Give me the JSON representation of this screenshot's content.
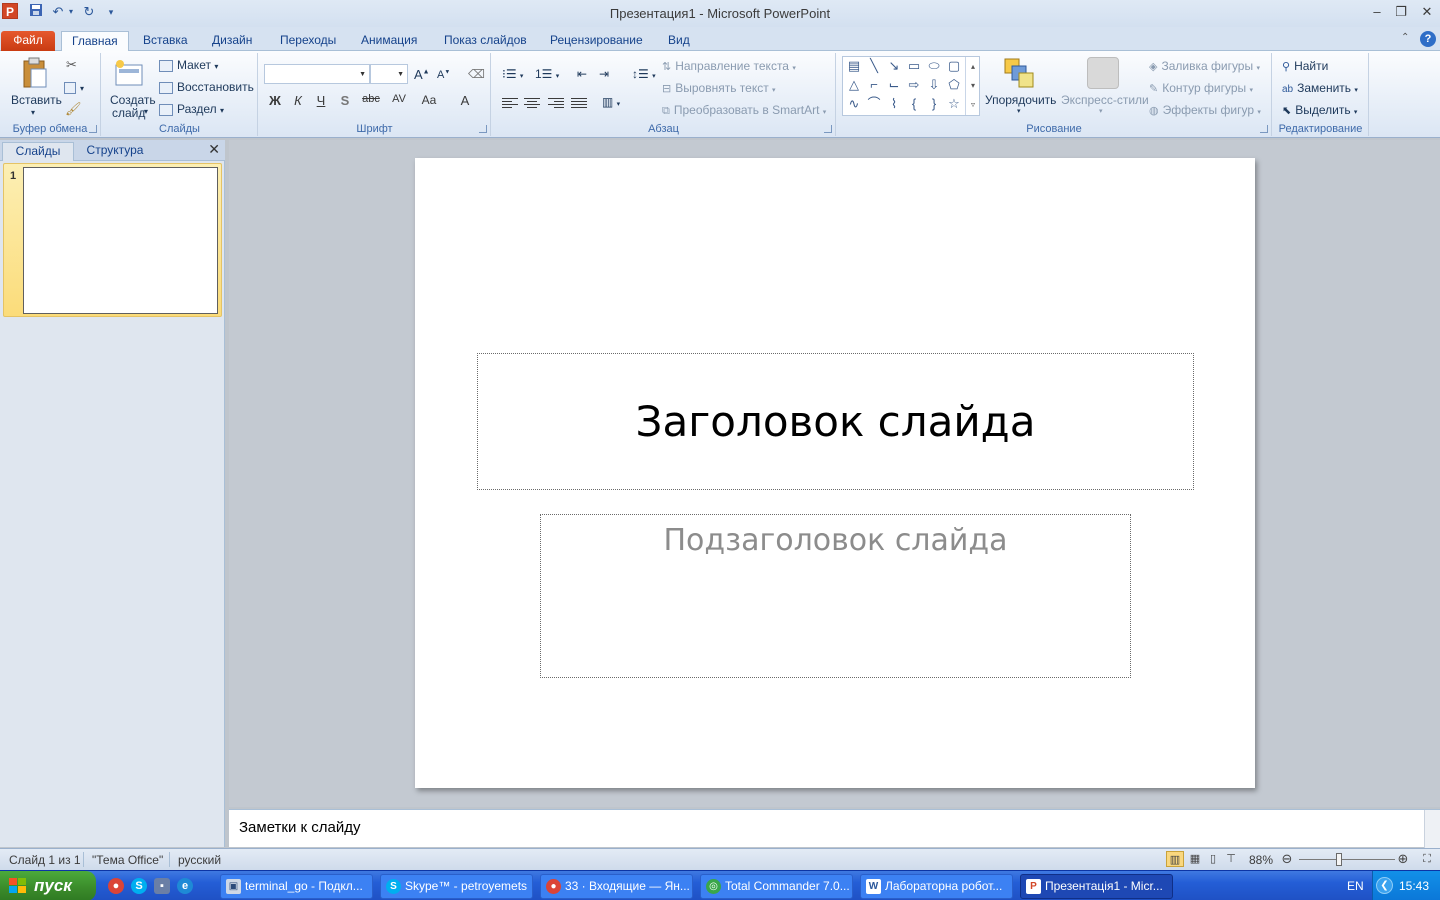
{
  "window": {
    "title": "Презентация1  -  Microsoft PowerPoint",
    "app_icon": "P"
  },
  "tabs": [
    {
      "label": "Файл"
    },
    {
      "label": "Главная"
    },
    {
      "label": "Вставка"
    },
    {
      "label": "Дизайн"
    },
    {
      "label": "Переходы"
    },
    {
      "label": "Анимация"
    },
    {
      "label": "Показ слайдов"
    },
    {
      "label": "Рецензирование"
    },
    {
      "label": "Вид"
    }
  ],
  "ribbon": {
    "clipboard": {
      "label": "Буфер обмена",
      "paste": "Вставить"
    },
    "slides": {
      "label": "Слайды",
      "new_slide_1": "Создать",
      "new_slide_2": "слайд",
      "layout": "Макет",
      "reset": "Восстановить",
      "section": "Раздел"
    },
    "font": {
      "label": "Шрифт",
      "bold": "Ж",
      "italic": "К",
      "underline": "Ч",
      "shadow": "S",
      "strike": "abc",
      "spacing": "AV",
      "case": "Aa",
      "color": "A"
    },
    "paragraph": {
      "label": "Абзац",
      "text_direction": "Направление текста",
      "align_text": "Выровнять текст",
      "smartart": "Преобразовать в SmartArt"
    },
    "drawing": {
      "label": "Рисование",
      "arrange": "Упорядочить",
      "quick_styles": "Экспресс-стили",
      "fill": "Заливка фигуры",
      "outline": "Контур фигуры",
      "effects": "Эффекты фигур"
    },
    "editing": {
      "label": "Редактирование",
      "find": "Найти",
      "replace": "Заменить",
      "select": "Выделить"
    }
  },
  "left_panel": {
    "tabs": [
      {
        "label": "Слайды"
      },
      {
        "label": "Структура"
      }
    ],
    "slide_number": "1"
  },
  "slide": {
    "title_placeholder": "Заголовок слайда",
    "subtitle_placeholder": "Подзаголовок слайда"
  },
  "notes": {
    "placeholder": "Заметки к слайду"
  },
  "status": {
    "slide_info": "Слайд 1 из 1",
    "theme": "\"Тема Office\"",
    "language": "русский",
    "zoom": "88%"
  },
  "taskbar": {
    "start": "пуск",
    "tasks": [
      {
        "label": "terminal_go - Подкл..."
      },
      {
        "label": "Skype™ - petroyemets"
      },
      {
        "label": "33 · Входящие — Ян..."
      },
      {
        "label": "Total Commander 7.0..."
      },
      {
        "label": "Лабораторна робот..."
      },
      {
        "label": "Презентація1 - Micr..."
      }
    ],
    "lang": "EN",
    "clock": "15:43"
  },
  "colors": {
    "file_tab": "#d24726",
    "taskbar": "#245ed6",
    "start": "#3a8a2a",
    "slide_bg": "#ffffff",
    "subtitle_text": "#8c8c8c"
  }
}
